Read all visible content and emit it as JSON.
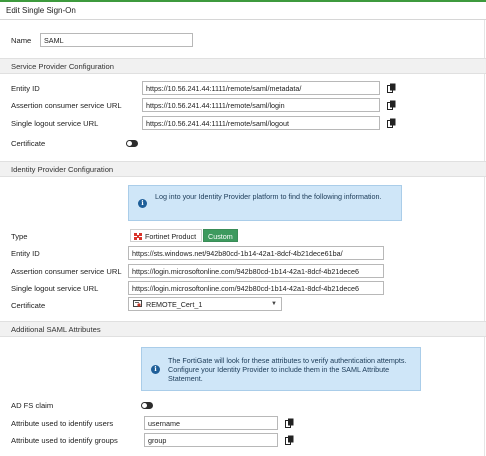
{
  "title": "Edit Single Sign-On",
  "name": {
    "label": "Name",
    "value": "SAML"
  },
  "sp": {
    "header": "Service Provider Configuration",
    "entity_id": {
      "label": "Entity ID",
      "value": "https://10.56.241.44:1111/remote/saml/metadata/"
    },
    "acs_url": {
      "label": "Assertion consumer service URL",
      "value": "https://10.56.241.44:1111/remote/saml/login"
    },
    "slo_url": {
      "label": "Single logout service URL",
      "value": "https://10.56.241.44:1111/remote/saml/logout"
    },
    "certificate": {
      "label": "Certificate",
      "enabled": false
    }
  },
  "idp": {
    "header": "Identity Provider Configuration",
    "info": "Log into your Identity Provider platform to find the following information.",
    "type": {
      "label": "Type",
      "options": [
        "Fortinet Product",
        "Custom"
      ],
      "selected": "Custom"
    },
    "entity_id": {
      "label": "Entity ID",
      "value": "https://sts.windows.net/942b80cd-1b14-42a1-8dcf-4b21dece61ba/"
    },
    "acs_url": {
      "label": "Assertion consumer service URL",
      "value": "https://login.microsoftonline.com/942b80cd-1b14-42a1-8dcf-4b21dece6"
    },
    "slo_url": {
      "label": "Single logout service URL",
      "value": "https://login.microsoftonline.com/942b80cd-1b14-42a1-8dcf-4b21dece6"
    },
    "certificate": {
      "label": "Certificate",
      "value": "REMOTE_Cert_1"
    }
  },
  "attrs": {
    "header": "Additional SAML Attributes",
    "info": "The FortiGate will look for these attributes to verify authentication attempts. Configure your Identity Provider to include them in the SAML Attribute Statement.",
    "adfs": {
      "label": "AD FS claim",
      "enabled": false
    },
    "users": {
      "label": "Attribute used to identify users",
      "value": "username"
    },
    "groups": {
      "label": "Attribute used to identify groups",
      "value": "group"
    }
  },
  "colors": {
    "accent_green": "#3d9a5e",
    "info_bg": "#cfe6f8",
    "info_icon": "#1f5f99"
  },
  "icons": {
    "copy": "copy-icon",
    "info": "info-icon",
    "fortinet": "fortinet-logo-icon",
    "certificate": "certificate-icon",
    "dropdown": "chevron-down-icon"
  }
}
